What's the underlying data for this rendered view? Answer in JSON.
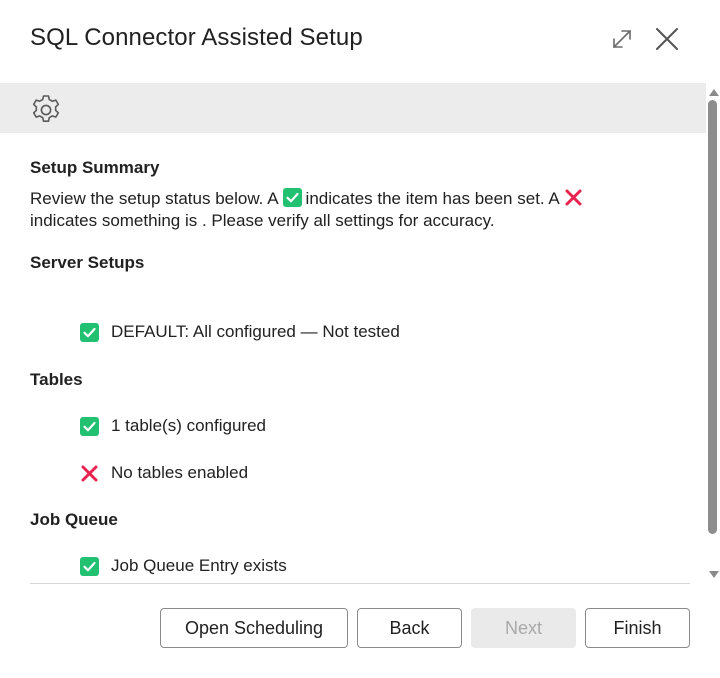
{
  "dialog": {
    "title": "SQL Connector Assisted Setup"
  },
  "window_controls": {
    "expand_icon": "expand-diagonal-icon",
    "close_icon": "close-x-icon"
  },
  "banner": {
    "icon": "gear-icon"
  },
  "summary": {
    "heading": "Setup Summary",
    "text_part1": "Review the setup status below. A",
    "text_part2": "indicates the item has been set. A",
    "text_line2": "indicates something is . Please verify all settings for accuracy."
  },
  "sections": {
    "server": {
      "heading": "Server Setups",
      "items": [
        {
          "status": "check",
          "label": "DEFAULT: All configured — Not tested"
        }
      ]
    },
    "tables": {
      "heading": "Tables",
      "items": [
        {
          "status": "check",
          "label": "1 table(s) configured"
        },
        {
          "status": "cross",
          "label": "No tables enabled"
        }
      ]
    },
    "job_queue": {
      "heading": "Job Queue",
      "items": [
        {
          "status": "check",
          "label": "Job Queue Entry exists"
        }
      ]
    }
  },
  "footer": {
    "open_scheduling": "Open Scheduling",
    "back": "Back",
    "next": "Next",
    "finish": "Finish"
  },
  "colors": {
    "check": "#21c171",
    "cross": "#e8234f",
    "banner": "#ececec"
  }
}
